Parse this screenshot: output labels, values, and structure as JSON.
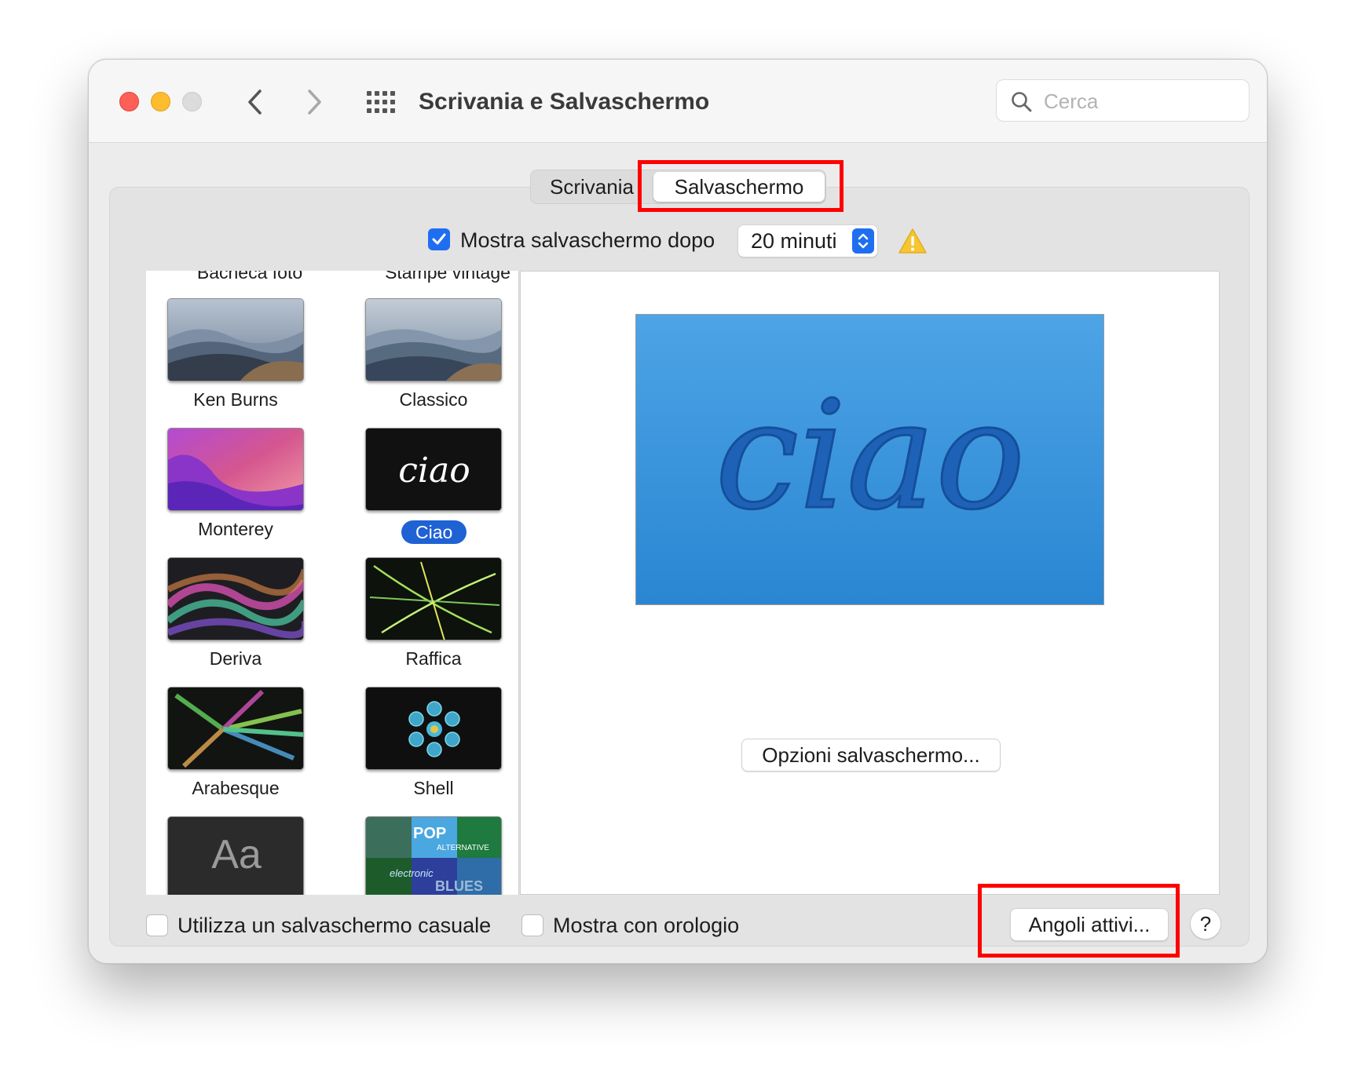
{
  "window": {
    "title": "Scrivania e Salvaschermo"
  },
  "search": {
    "placeholder": "Cerca"
  },
  "tabs": [
    {
      "label": "Scrivania",
      "selected": false
    },
    {
      "label": "Salvaschermo",
      "selected": true
    }
  ],
  "options": {
    "show_after_label": "Mostra salvaschermo dopo",
    "show_after_checked": true,
    "delay_value": "20 minuti"
  },
  "savers": {
    "partial_top": [
      "Bacheca foto",
      "Stampe vintage"
    ],
    "items": [
      {
        "label": "Ken Burns"
      },
      {
        "label": "Classico"
      },
      {
        "label": "Monterey"
      },
      {
        "label": "Ciao",
        "selected": true
      },
      {
        "label": "Deriva"
      },
      {
        "label": "Raffica"
      },
      {
        "label": "Arabesque"
      },
      {
        "label": "Shell"
      }
    ],
    "partial_bottom": [
      "Aa",
      "POP",
      "ALTERNATIVE",
      "electronic",
      "BLUES"
    ]
  },
  "preview": {
    "text": "ciao"
  },
  "buttons": {
    "options": "Opzioni salvaschermo...",
    "hot_corners": "Angoli attivi...",
    "help": "?"
  },
  "bottom": {
    "random_label": "Utilizza un salvaschermo casuale",
    "clock_label": "Mostra con orologio"
  },
  "colors": {
    "accent": "#1f6ef0",
    "highlight_box": "#ff0000",
    "preview_blue": "#3a95dc"
  }
}
